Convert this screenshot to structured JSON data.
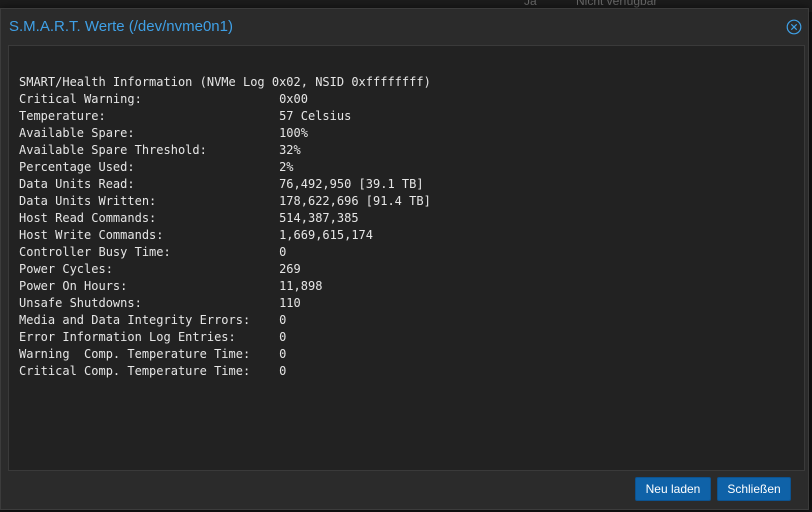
{
  "background": {
    "col1": "Ja",
    "col2": "Nicht verfügbar"
  },
  "dialog": {
    "title": "S.M.A.R.T. Werte (/dev/nvme0n1)",
    "close_icon": "circle-x-icon",
    "accent_color": "#3fa0e6",
    "output_lines": [
      "SMART/Health Information (NVMe Log 0x02, NSID 0xffffffff)",
      "Critical Warning:                   0x00",
      "Temperature:                        57 Celsius",
      "Available Spare:                    100%",
      "Available Spare Threshold:          32%",
      "Percentage Used:                    2%",
      "Data Units Read:                    76,492,950 [39.1 TB]",
      "Data Units Written:                 178,622,696 [91.4 TB]",
      "Host Read Commands:                 514,387,385",
      "Host Write Commands:                1,669,615,174",
      "Controller Busy Time:               0",
      "Power Cycles:                       269",
      "Power On Hours:                     11,898",
      "Unsafe Shutdowns:                   110",
      "Media and Data Integrity Errors:    0",
      "Error Information Log Entries:      0",
      "Warning  Comp. Temperature Time:    0",
      "Critical Comp. Temperature Time:    0"
    ],
    "buttons": {
      "reload_label": "Neu laden",
      "close_label": "Schließen",
      "button_color": "#0f62a8"
    }
  }
}
